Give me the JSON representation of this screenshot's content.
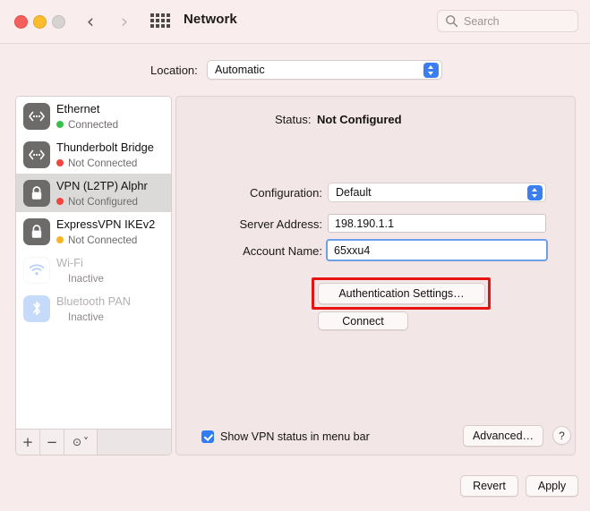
{
  "window": {
    "title": "Network",
    "traffic_lights": [
      "close",
      "minimize",
      "zoom"
    ]
  },
  "toolbar": {
    "back_icon": "‹",
    "forward_icon": "›",
    "grid_icon": "grid-icon",
    "search": {
      "placeholder": "Search",
      "icon": "search-icon"
    }
  },
  "location": {
    "label": "Location:",
    "value": "Automatic"
  },
  "sidebar": {
    "services": [
      {
        "name": "Ethernet",
        "status": "Connected",
        "status_color": "#39c04a",
        "dot": "green",
        "icon": "ethernet-icon",
        "icon_style": "dark",
        "selected": false,
        "faded": false
      },
      {
        "name": "Thunderbolt Bridge",
        "status": "Not Connected",
        "status_color": "#f1453d",
        "dot": "red",
        "icon": "ethernet-icon",
        "icon_style": "dark",
        "selected": false,
        "faded": false
      },
      {
        "name": "VPN (L2TP) Alphr",
        "status": "Not Configured",
        "status_color": "#f1453d",
        "dot": "red",
        "icon": "lock-icon",
        "icon_style": "dark",
        "selected": true,
        "faded": false
      },
      {
        "name": "ExpressVPN IKEv2",
        "status": "Not Connected",
        "status_color": "#f6b527",
        "dot": "orange",
        "icon": "lock-icon",
        "icon_style": "dark",
        "selected": false,
        "faded": false
      },
      {
        "name": "Wi-Fi",
        "status": "Inactive",
        "status_color": "#8e8989",
        "dot": "none",
        "icon": "wifi-icon",
        "icon_style": "wifi",
        "selected": false,
        "faded": true
      },
      {
        "name": "Bluetooth PAN",
        "status": "Inactive",
        "status_color": "#8e8989",
        "dot": "none",
        "icon": "bluetooth-icon",
        "icon_style": "bt",
        "selected": false,
        "faded": true
      }
    ],
    "toolbar": {
      "add_label": "+",
      "remove_label": "−",
      "action_label": "⊙",
      "action_chevron": "˅"
    }
  },
  "panel": {
    "status_label": "Status:",
    "status_value": "Not Configured",
    "configuration_label": "Configuration:",
    "configuration_value": "Default",
    "server_address_label": "Server Address:",
    "server_address_value": "198.190.1.1",
    "account_name_label": "Account Name:",
    "account_name_value": "65xxu4",
    "auth_settings_label": "Authentication Settings…",
    "connect_label": "Connect",
    "show_vpn_label": "Show VPN status in menu bar",
    "show_vpn_checked": true,
    "advanced_label": "Advanced…",
    "help_label": "?"
  },
  "footer": {
    "revert_label": "Revert",
    "apply_label": "Apply"
  },
  "annotation": {
    "highlight_color": "#e81313",
    "target": "auth-settings-button"
  }
}
